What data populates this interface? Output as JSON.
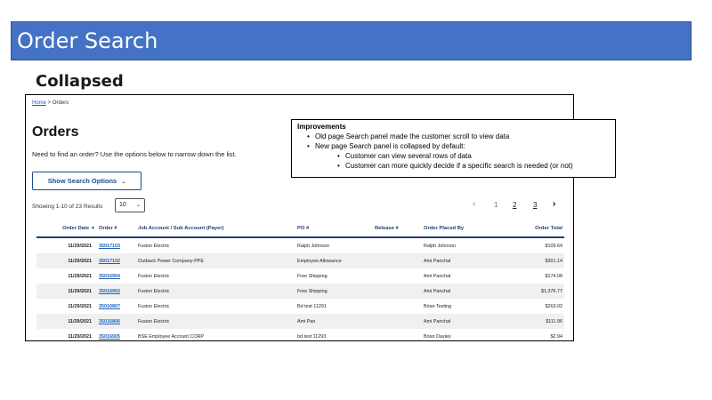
{
  "slide": {
    "title": "Order Search",
    "subtitle": "Collapsed"
  },
  "breadcrumb": {
    "home": "Home",
    "separator": " > ",
    "current": "Orders"
  },
  "page": {
    "heading": "Orders",
    "intro": "Need to find an order? Use the options below to narrow down the list.",
    "show_search_label": "Show Search Options",
    "showing_text": "Showing 1-10 of 23 Results",
    "per_page_value": "10"
  },
  "pagination": {
    "prev": "‹",
    "pages": [
      "1",
      "2",
      "3"
    ],
    "next": "›"
  },
  "table": {
    "headers": [
      "Order Date",
      "Order #",
      "Job Account / Sub Account (Payer)",
      "PO #",
      "Release #",
      "Order Placed By",
      "Order Total"
    ],
    "rows": [
      [
        "11/29/2021",
        "35017103",
        "Fusion Electric",
        "Ralph Johnson",
        "",
        "Ralph Johnson",
        "$109.64"
      ],
      [
        "11/29/2021",
        "35017102",
        "Outback Power Company-PPE",
        "Employee Allowance",
        "",
        "Ami Panchal",
        "$301.14"
      ],
      [
        "11/29/2021",
        "35016904",
        "Fusion Electric",
        "Free Shipping",
        "",
        "Ami Panchal",
        "$174.08"
      ],
      [
        "11/29/2021",
        "35016902",
        "Fusion Electric",
        "Free Shipping",
        "",
        "Ami Panchal",
        "$1,376.77"
      ],
      [
        "11/29/2021",
        "35016807",
        "Fusion Electric",
        "Bd test 11291",
        "",
        "Brian Testing",
        "$263.02"
      ],
      [
        "11/29/2021",
        "35016806",
        "Fusion Electric",
        "Ami Pan",
        "",
        "Ami Panchal",
        "$111.96"
      ],
      [
        "11/29/2021",
        "35016905",
        "BSE Employee Account CORP",
        "bd test 11293",
        "",
        "Brian Davies",
        "$2.94"
      ]
    ]
  },
  "callout": {
    "heading": "Improvements",
    "items": [
      "Old page Search panel made the customer scroll to view data",
      "New page Search panel is collapsed by default:",
      "Customer can view several rows of data",
      "Customer can more quickly decide if a specific search is needed (or not)"
    ]
  },
  "colors": {
    "title_bar": "#4472c4",
    "link": "#1f5fbf",
    "primary": "#1e3f73"
  },
  "icons": {
    "search_chevron": "chevron-down-icon",
    "select_chevron": "chevron-down-icon",
    "sort_chevron": "chevron-down-icon",
    "prev": "chevron-left-icon",
    "next": "chevron-right-icon"
  }
}
